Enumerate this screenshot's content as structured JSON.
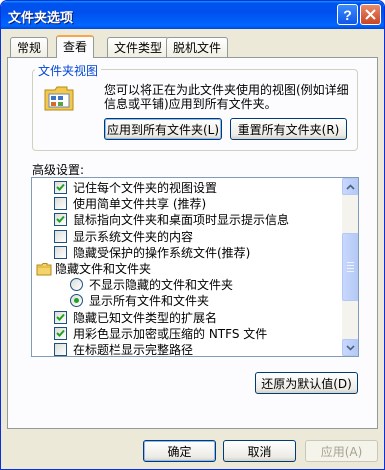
{
  "window": {
    "title": "文件夹选项",
    "help_glyph": "?"
  },
  "tabs": [
    {
      "label": "常规",
      "active": false
    },
    {
      "label": "查看",
      "active": true
    },
    {
      "label": "文件类型",
      "active": false
    },
    {
      "label": "脱机文件",
      "active": false
    }
  ],
  "folder_views": {
    "group_title": "文件夹视图",
    "description_line1": "您可以将正在为此文件夹使用的视图(例如详细",
    "description_line2": "信息或平铺)应用到所有文件夹。",
    "apply_all_label": "应用到所有文件夹(L)",
    "reset_all_label": "重置所有文件夹(R)",
    "icon": "folder-view-icon"
  },
  "advanced": {
    "label": "高级设置:",
    "items": [
      {
        "type": "checkbox",
        "checked": true,
        "indent": 1,
        "label": "记住每个文件夹的视图设置"
      },
      {
        "type": "checkbox",
        "checked": false,
        "indent": 1,
        "label": "使用简单文件共享 (推荐)"
      },
      {
        "type": "checkbox",
        "checked": true,
        "indent": 1,
        "label": "鼠标指向文件夹和桌面项时显示提示信息"
      },
      {
        "type": "checkbox",
        "checked": false,
        "indent": 1,
        "label": "显示系统文件夹的内容"
      },
      {
        "type": "checkbox",
        "checked": false,
        "indent": 1,
        "label": "隐藏受保护的操作系统文件(推荐)"
      },
      {
        "type": "folder",
        "checked": false,
        "indent": 0,
        "label": "隐藏文件和文件夹"
      },
      {
        "type": "radio",
        "checked": false,
        "indent": 2,
        "label": "不显示隐藏的文件和文件夹"
      },
      {
        "type": "radio",
        "checked": true,
        "indent": 2,
        "label": "显示所有文件和文件夹"
      },
      {
        "type": "checkbox",
        "checked": true,
        "indent": 1,
        "label": "隐藏已知文件类型的扩展名"
      },
      {
        "type": "checkbox",
        "checked": true,
        "indent": 1,
        "label": "用彩色显示加密或压缩的 NTFS 文件"
      },
      {
        "type": "checkbox",
        "checked": false,
        "indent": 1,
        "label": "在标题栏显示完整路径"
      }
    ]
  },
  "restore_defaults_label": "还原为默认值(D)",
  "footer": {
    "ok_label": "确定",
    "cancel_label": "取消",
    "apply_label": "应用(A)"
  },
  "colors": {
    "title_bar": "#0053ee",
    "accent_tab": "#f9a64b",
    "group_title": "#0046d5",
    "check_mark": "#21a121"
  }
}
